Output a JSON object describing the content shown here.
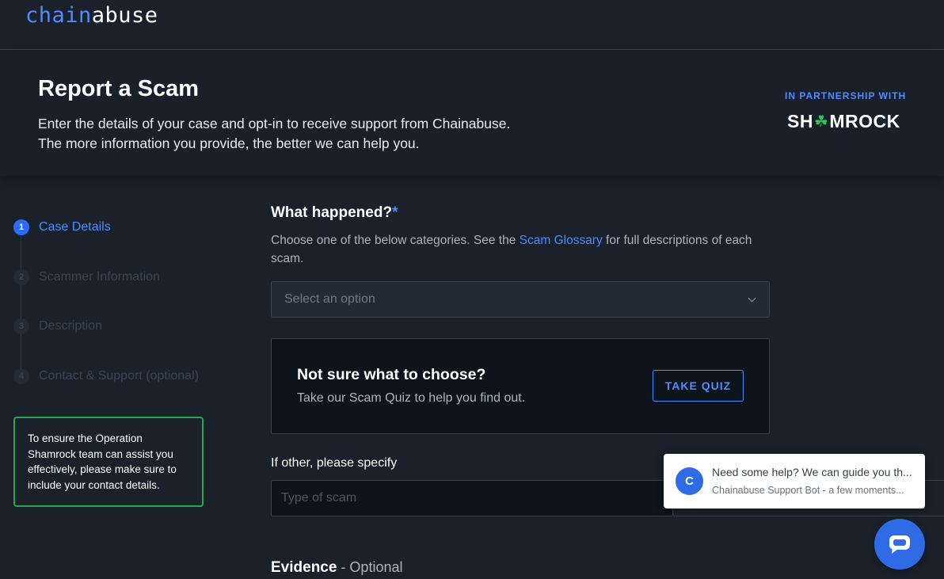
{
  "brand": {
    "part1": "chain",
    "part2": "abuse"
  },
  "hero": {
    "title": "Report a Scam",
    "subtitle_line1": "Enter the details of your case and opt-in to receive support from Chainabuse.",
    "subtitle_line2": "The more information you provide, the better we can help you.",
    "partner_label": "IN PARTNERSHIP WITH",
    "partner_name_pre": "SH",
    "partner_name_post": "MROCK"
  },
  "steps": [
    {
      "number": "1",
      "label": "Case Details",
      "active": true
    },
    {
      "number": "2",
      "label": "Scammer Information",
      "active": false
    },
    {
      "number": "3",
      "label": "Description",
      "active": false
    },
    {
      "number": "4",
      "label": "Contact & Support (optional)",
      "active": false
    }
  ],
  "notice": "To ensure the Operation Shamrock team can assist you effectively, please make sure to include your contact details.",
  "question": {
    "title": "What happened?",
    "required_mark": "*",
    "desc_pre": "Choose one of the below categories. See the ",
    "desc_link": "Scam Glossary",
    "desc_post": " for full descriptions of each scam.",
    "select_placeholder": "Select an option"
  },
  "quiz": {
    "title": "Not sure what to choose?",
    "subtitle": "Take our Scam Quiz to help you find out.",
    "button": "TAKE QUIZ"
  },
  "other": {
    "label": "If other, please specify",
    "placeholder": "Type of scam"
  },
  "evidence": {
    "title": "Evidence",
    "optional": " - Optional"
  },
  "chat": {
    "avatar_letter": "C",
    "message": "Need some help? We can guide you th...",
    "meta": "Chainabuse Support Bot - a few moments...",
    "fab_icon": "chat-bubble-icon"
  },
  "colors": {
    "accent": "#4d8dff",
    "background": "#1a212b",
    "notice_border": "#2da44e",
    "chat_blue": "#2f6be4"
  }
}
